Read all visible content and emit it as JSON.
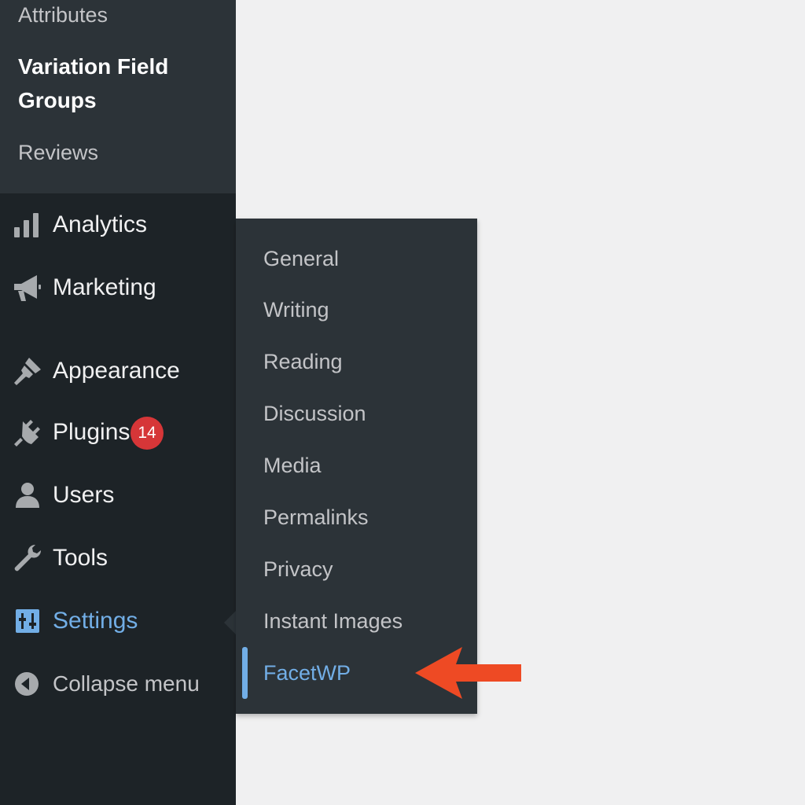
{
  "submenu": {
    "attributes": "Attributes",
    "current": "Variation Field Groups",
    "reviews": "Reviews"
  },
  "menu": {
    "analytics": {
      "label": "Analytics",
      "icon": "bar-chart-icon"
    },
    "marketing": {
      "label": "Marketing",
      "icon": "megaphone-icon"
    },
    "appearance": {
      "label": "Appearance",
      "icon": "paintbrush-icon"
    },
    "plugins": {
      "label": "Plugins",
      "icon": "plugin-icon",
      "badge": "14"
    },
    "users": {
      "label": "Users",
      "icon": "user-icon"
    },
    "tools": {
      "label": "Tools",
      "icon": "wrench-icon"
    },
    "settings": {
      "label": "Settings",
      "icon": "settings-sliders-icon"
    },
    "collapse": {
      "label": "Collapse menu",
      "icon": "collapse-arrow-icon"
    }
  },
  "flyout": {
    "items": [
      "General",
      "Writing",
      "Reading",
      "Discussion",
      "Media",
      "Permalinks",
      "Privacy",
      "Instant Images",
      "FacetWP"
    ],
    "current": "FacetWP"
  },
  "colors": {
    "sidebar": "#1d2327",
    "submenu": "#2c3338",
    "accent": "#72aee6",
    "badge": "#d63638",
    "annotation_arrow": "#ee4a24",
    "background": "#f0f0f1"
  }
}
